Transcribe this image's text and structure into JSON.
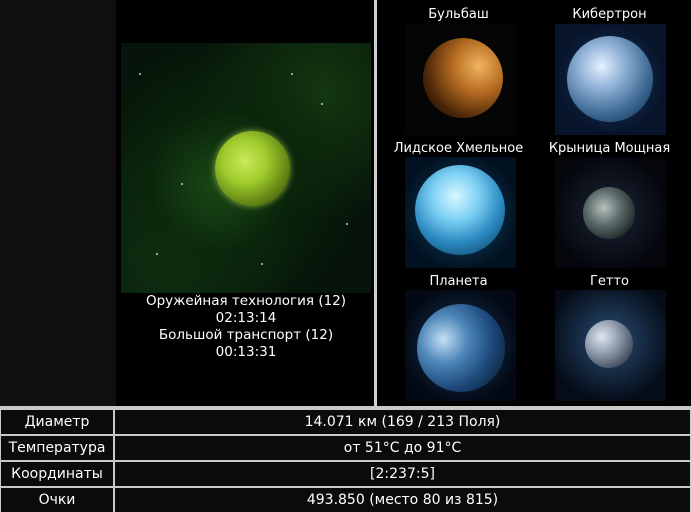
{
  "current_planet": {
    "research": [
      {
        "name": "Оружейная технология (12)",
        "time": "02:13:14"
      },
      {
        "name": "Большой транспорт (12)",
        "time": "00:13:31"
      }
    ]
  },
  "planets": [
    {
      "name": "Бульбаш",
      "icon": "planet-orange-icon"
    },
    {
      "name": "Кибертрон",
      "icon": "planet-blue-ice-icon"
    },
    {
      "name": "Лидское Хмельное",
      "icon": "planet-cyan-icon"
    },
    {
      "name": "Крыница Мощная",
      "icon": "planet-dark-icon"
    },
    {
      "name": "Планета",
      "icon": "planet-earth-icon"
    },
    {
      "name": "Гетто",
      "icon": "planet-grey-icon"
    }
  ],
  "info": [
    {
      "label": "Диаметр",
      "value": "14.071 км (169 / 213 Поля)"
    },
    {
      "label": "Температура",
      "value": "от 51°С до 91°С"
    },
    {
      "label": "Координаты",
      "value": "[2:237:5]"
    },
    {
      "label": "Очки",
      "value": "493.850 (место 80 из 815)"
    }
  ],
  "colors": {
    "background": "#000000",
    "divider": "#cfcfcf",
    "text": "#ffffff"
  }
}
